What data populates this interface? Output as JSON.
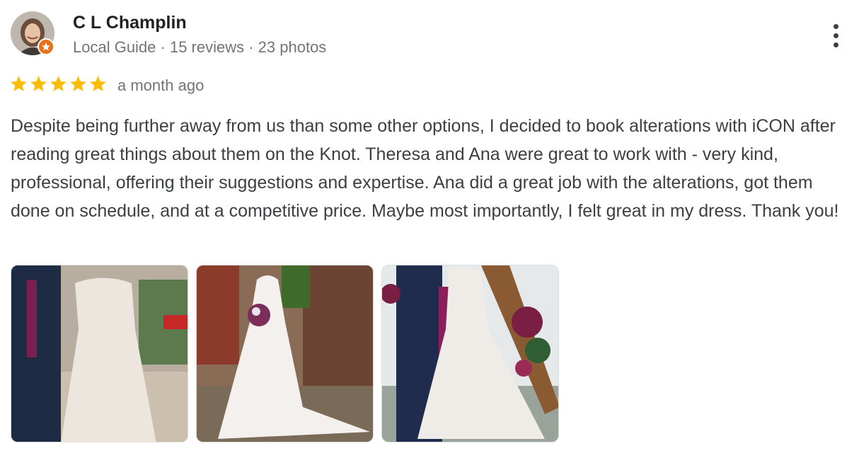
{
  "reviewer": {
    "name": "C L Champlin",
    "meta": "Local Guide · 15 reviews · 23 photos"
  },
  "review": {
    "rating": 5,
    "date": "a month ago",
    "text": "Despite being further away from us than some other options, I decided to book alterations with iCON after reading great things about them on the Knot. Theresa and Ana were great to work with - very kind, professional, offering their suggestions and expertise. Ana did a great job with the alterations, got them done on schedule, and at a competitive price. Maybe most importantly, I felt great in my dress. Thank you!"
  },
  "colors": {
    "star": "#fbbc04",
    "badge": "#e8711a"
  },
  "photos": [
    {
      "icon": "wedding-photo-icon"
    },
    {
      "icon": "wedding-photo-icon"
    },
    {
      "icon": "wedding-photo-icon"
    }
  ]
}
